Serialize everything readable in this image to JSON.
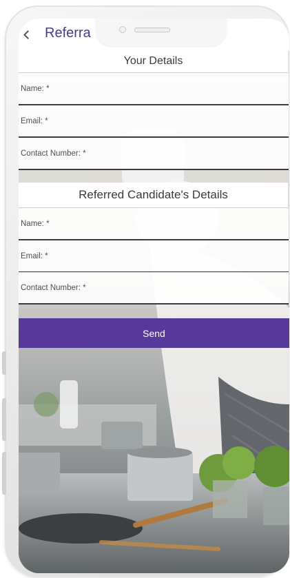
{
  "app_bar": {
    "title": "Referra",
    "back_icon": "back-arrow-icon"
  },
  "your_details": {
    "heading": "Your Details",
    "name": {
      "placeholder": "Name: *",
      "value": ""
    },
    "email": {
      "placeholder": "Email: *",
      "value": ""
    },
    "contact_number": {
      "placeholder": "Contact Number: *",
      "value": ""
    }
  },
  "candidate_details": {
    "heading": "Referred Candidate's Details",
    "name": {
      "placeholder": "Name: *",
      "value": ""
    },
    "email": {
      "placeholder": "Email: *",
      "value": ""
    },
    "contact_number": {
      "placeholder": "Contact Number: *",
      "value": ""
    }
  },
  "send_button": {
    "label": "Send"
  },
  "colors": {
    "accent": "#57399a",
    "title": "#4a3a8c",
    "field_divider": "#3b3b3b"
  }
}
